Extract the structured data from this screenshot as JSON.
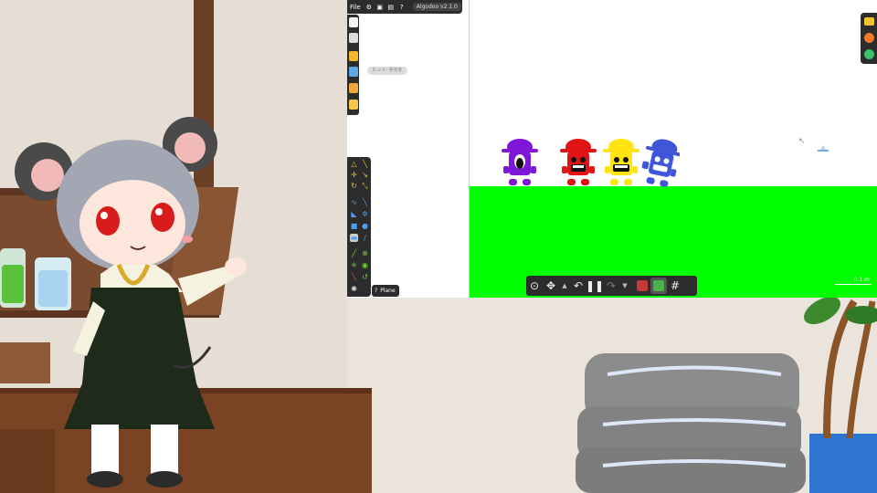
{
  "app": {
    "menu_file": "File",
    "title": "Algodoo v2.1.0",
    "tooltip": "ヒント: 手元を",
    "bottom_label": "Plane",
    "scale_label": "0.1 m"
  },
  "colors": {
    "ground": "#00ff00",
    "toolbar": "#2c2c2c",
    "purple": "#7f17d6",
    "red": "#e01414",
    "yellow": "#ffe312",
    "blue": "#3f56d9"
  },
  "characters": [
    "purple",
    "red",
    "yellow",
    "blue"
  ],
  "icons": {
    "menu": [
      "gear-icon",
      "window-icon",
      "options-icon",
      "help-icon"
    ],
    "left": [
      "new-scene-icon",
      "save-icon",
      "folder-icon",
      "scenes-icon",
      "open-icon",
      "snapshot-icon"
    ],
    "right": [
      "panel-icon",
      "palette-icon",
      "settings-icon"
    ],
    "bottom": [
      "zoom-icon",
      "pan-icon",
      "pause-icon",
      "undo-icon",
      "redo-icon",
      "visualization-icon",
      "grid-icon"
    ]
  }
}
